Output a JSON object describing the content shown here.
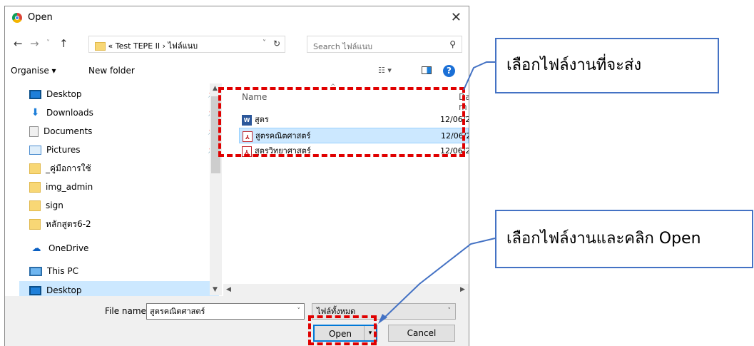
{
  "window": {
    "title": "Open"
  },
  "address": {
    "crumbs": "« Test TEPE II › ไฟล์แนบ",
    "search_placeholder": "Search ไฟล์แนบ"
  },
  "toolbar": {
    "organise": "Organise ▾",
    "new_folder": "New folder",
    "help": "?"
  },
  "sidebar": {
    "items": [
      {
        "label": "Desktop"
      },
      {
        "label": "Downloads"
      },
      {
        "label": "Documents"
      },
      {
        "label": "Pictures"
      },
      {
        "label": "_คู่มือการใช้"
      },
      {
        "label": "img_admin"
      },
      {
        "label": "sign"
      },
      {
        "label": "หลักสูตร6-2"
      },
      {
        "label": "OneDrive"
      },
      {
        "label": "This PC"
      },
      {
        "label": "Desktop"
      }
    ]
  },
  "files": {
    "col_name": "Name",
    "col_date": "Date m",
    "rows": [
      {
        "name": "สูตร",
        "date": "12/06/2"
      },
      {
        "name": "สูตรคณิตศาสตร์",
        "date": "12/06/2"
      },
      {
        "name": "สูตรวิทยาศาสตร์",
        "date": "12/06/2"
      }
    ]
  },
  "bottom": {
    "file_name_label": "File name:",
    "file_name_value": "สูตรคณิตศาสตร์",
    "file_type": "ไฟล์ทั้งหมด",
    "open": "Open",
    "cancel": "Cancel"
  },
  "callouts": {
    "top": "เลือกไฟล์งานที่จะส่ง",
    "bottom": "เลือกไฟล์งานและคลิก Open"
  },
  "colors": {
    "annotation_red": "#e00000",
    "callout_border": "#4472c4",
    "selection": "#cce8ff"
  }
}
